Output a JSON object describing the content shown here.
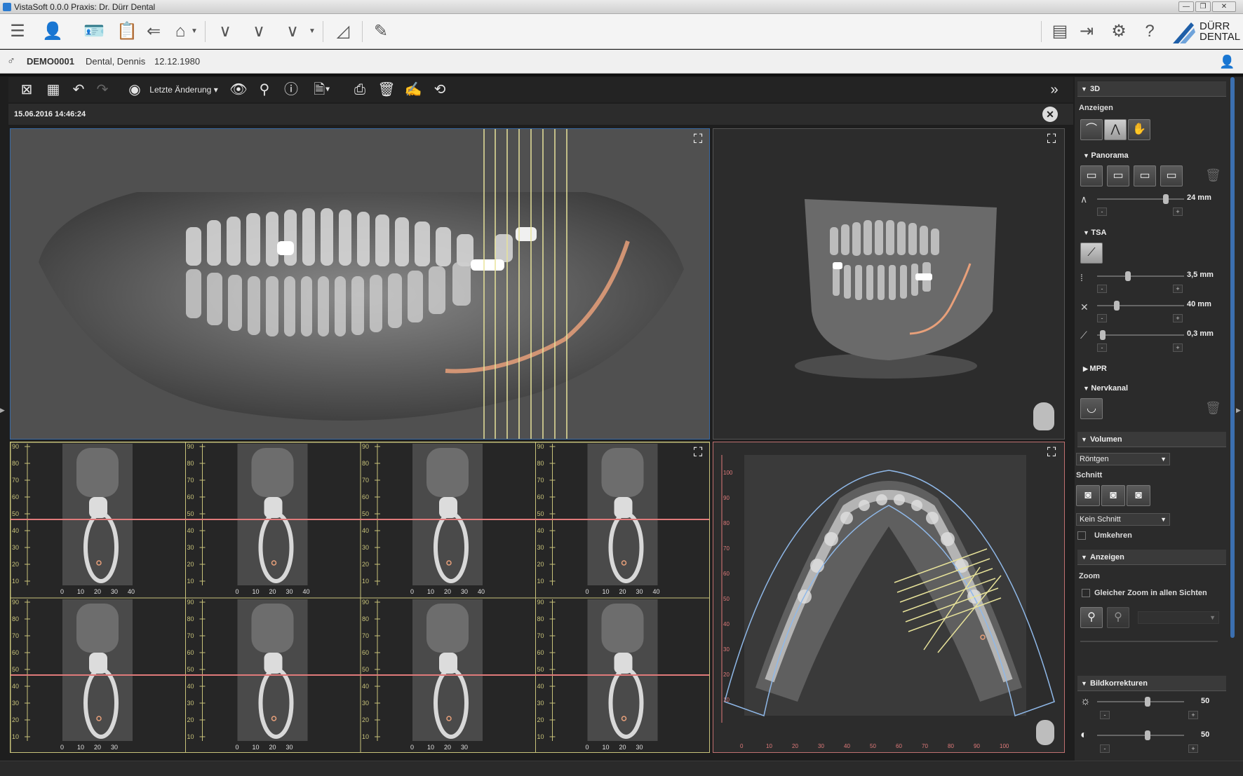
{
  "window": {
    "title": "VistaSoft 0.0.0 Praxis: Dr. Dürr Dental"
  },
  "brand": {
    "line1": "DÜRR",
    "line2": "DENTAL",
    "color": "#1f5fa8"
  },
  "patient": {
    "id": "DEMO0001",
    "name": "Dental, Dennis",
    "dob": "12.12.1980"
  },
  "viewtoolbar": {
    "history_label": "Letzte Änderung"
  },
  "exam": {
    "datetime": "15.06.2016 14:46:24"
  },
  "axes": {
    "cross_y": [
      "90",
      "80",
      "70",
      "60",
      "50",
      "40",
      "30",
      "20",
      "10"
    ],
    "cross_x_top": [
      "0",
      "10",
      "20",
      "30",
      "40"
    ],
    "cross_x_bottom": [
      "0",
      "10",
      "20",
      "30"
    ],
    "axial_y": [
      "100",
      "90",
      "80",
      "70",
      "60",
      "50",
      "40",
      "30",
      "20",
      "10"
    ],
    "axial_x": [
      "0",
      "10",
      "20",
      "30",
      "40",
      "50",
      "60",
      "70",
      "80",
      "90",
      "100"
    ]
  },
  "sidebar": {
    "section_3d": "3D",
    "anzeigen_label": "Anzeigen",
    "panorama": "Panorama",
    "panorama_value": "24 mm",
    "tsa": "TSA",
    "tsa_values": [
      "3,5 mm",
      "40 mm",
      "0,3 mm"
    ],
    "mpr": "MPR",
    "nervkanal": "Nervkanal",
    "volumen": "Volumen",
    "volumen_select": "Röntgen",
    "schnitt": "Schnitt",
    "schnitt_select": "Kein Schnitt",
    "umkehren": "Umkehren",
    "anzeigen_section": "Anzeigen",
    "zoom": "Zoom",
    "gleicher_zoom": "Gleicher Zoom in allen Sichten",
    "bildkorrekturen": "Bildkorrekturen",
    "brightness_value": "50",
    "contrast_value": "50"
  },
  "colors": {
    "accent": "#1f5fa8",
    "guide_yellow": "#e8e39a",
    "nerve": "#e8a07a",
    "ref_red": "#e07a7a",
    "arch_blue": "#8fb8e8"
  },
  "icons": [
    "list-icon",
    "patient-icon",
    "patient-card-icon",
    "clipboard-icon",
    "import-icon",
    "tooth-icon",
    "arch-icon",
    "settings-icon",
    "help-icon"
  ]
}
